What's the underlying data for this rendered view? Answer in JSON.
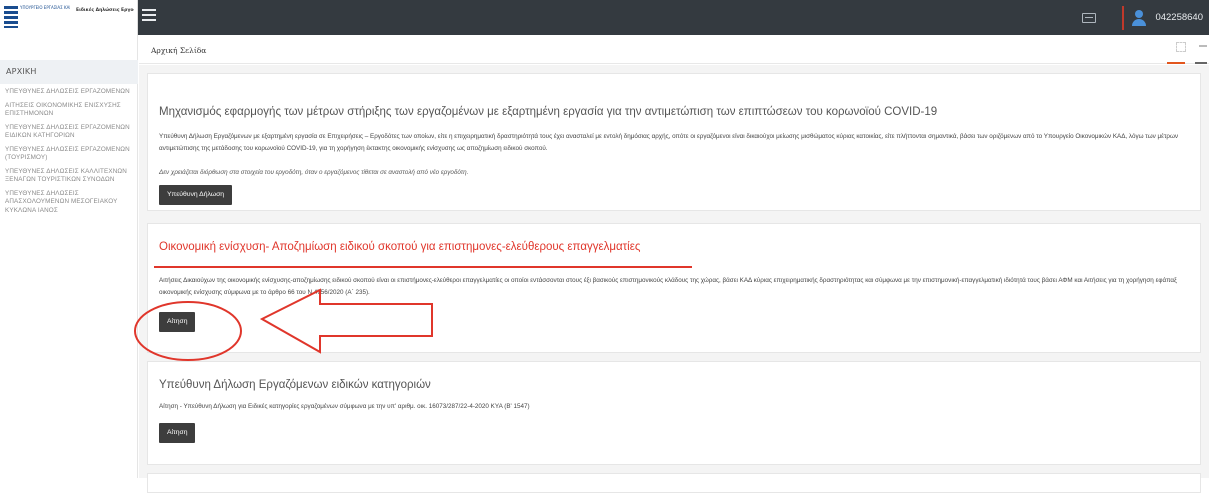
{
  "header": {
    "logo_text_left": "ΥΠΟΥΡΓΕΙΟ ΕΡΓΑΣΙΑΣ ΚΑΙ ΚΟΙΝΩΝΙΚΩΝ ΥΠΟΘΕΣΕΩΝ",
    "logo_text_right": "Ειδικές Δηλώσεις Εργοδοτών",
    "user_id": "042258640"
  },
  "breadcrumb": {
    "current": "Αρχική Σελίδα"
  },
  "sidebar": {
    "home_label": "ΑΡΧΙΚΗ",
    "items": [
      {
        "label": "ΥΠΕΥΘΥΝΕΣ ΔΗΛΩΣΕΙΣ ΕΡΓΑΖΟΜΕΝΩΝ"
      },
      {
        "label": "ΑΙΤΗΣΕΙΣ ΟΙΚΟΝΟΜΙΚΗΣ ΕΝΙΣΧΥΣΗΣ ΕΠΙΣΤΗΜΟΝΩΝ"
      },
      {
        "label": "ΥΠΕΥΘΥΝΕΣ ΔΗΛΩΣΕΙΣ ΕΡΓΑΖΟΜΕΝΩΝ ΕΙΔΙΚΩΝ ΚΑΤΗΓΟΡΙΩΝ"
      },
      {
        "label": "ΥΠΕΥΘΥΝΕΣ ΔΗΛΩΣΕΙΣ ΕΡΓΑΖΟΜΕΝΩΝ (ΤΟΥΡΙΣΜΟΥ)"
      },
      {
        "label": "ΥΠΕΥΘΥΝΕΣ ΔΗΛΩΣΕΙΣ ΚΑΛΛΙΤΕΧΝΩΝ ΞΕΝΑΓΩΝ ΤΟΥΡΙΣΤΙΚΩΝ ΣΥΝΟΔΩΝ"
      },
      {
        "label": "ΥΠΕΥΘΥΝΕΣ ΔΗΛΩΣΕΙΣ ΑΠΑΣΧΟΛΟΥΜΕΝΩΝ ΜΕΣΟΓΕΙΑΚΟΥ ΚΥΚΛΩΝΑ ΙΑΝΟΣ"
      }
    ]
  },
  "panels": [
    {
      "title": "Μηχανισμός εφαρμογής των μέτρων στήριξης των εργαζομένων με εξαρτημένη εργασία για την αντιμετώπιση των επιπτώσεων του κορωνοϊού COVID-19",
      "text": "Υπεύθυνη Δήλωση Εργαζόμενων με εξαρτημένη εργασία σε Επιχειρήσεις – Εργοδότες των οποίων, είτε η επιχειρηματική δραστηριότητά τους έχει ανασταλεί με εντολή δημόσιας αρχής, οπότε οι εργαζόμενοι είναι δικαιούχοι μείωσης μισθώματος κύριας κατοικίας, είτε πλήττονται σημαντικά, βάσει των οριζόμενων από το Υπουργείο Οικονομικών ΚΑΔ, λόγω των μέτρων αντιμετώπισης της μετάδοσης του κορωνοϊού COVID-19, για τη χορήγηση έκτακτης οικονομικής ενίσχυσης ως αποζημίωση ειδικού σκοπού.",
      "note": "Δεν χρειάζεται διόρθωση στα στοιχεία του εργοδότη, όταν ο εργαζόμενος τίθεται σε αναστολή από νέο εργοδότη.",
      "button": "Υπεύθυνη Δήλωση"
    },
    {
      "title": "Οικονομική ενίσχυση- Αποζημίωση ειδικού σκοπού για επιστημονες-ελεύθερους επαγγελματίες",
      "text": "Αιτήσεις Δικαιούχων της οικονομικής ενίσχυσης-αποζημίωσης ειδικού σκοπού είναι οι επιστήμονες-ελεύθεροι επαγγελματίες οι οποίοι εντάσσονται στους έξι βασικούς επιστημονικούς κλάδους της χώρας, βάσει ΚΑΔ κύριας επιχειρηματικής δραστηριότητας και σύμφωνα με την επιστημονική-επαγγελματική ιδιότητά τους βάσει ΑΦΜ και Αιτήσεις για τη χορήγηση εφάπαξ οικονομικής ενίσχυσης σύμφωνα με το άρθρο 66 του Ν.4756/2020 (Α΄ 235).",
      "button": "Αίτηση"
    },
    {
      "title": "Υπεύθυνη Δήλωση Εργαζόμενων ειδικών κατηγοριών",
      "text": "Αίτηση - Υπεύθυνη Δήλωση για Ειδικές κατηγορίες εργαζομένων σύμφωνα με την υπ' αριθμ. οικ. 16073/287/22-4-2020 ΚΥΑ (Β' 1547)",
      "button": "Αίτηση"
    }
  ],
  "colors": {
    "topbar": "#343a40",
    "accent_red": "#e0362b",
    "button": "#3d3d3d",
    "user_icon": "#4a90d9"
  }
}
